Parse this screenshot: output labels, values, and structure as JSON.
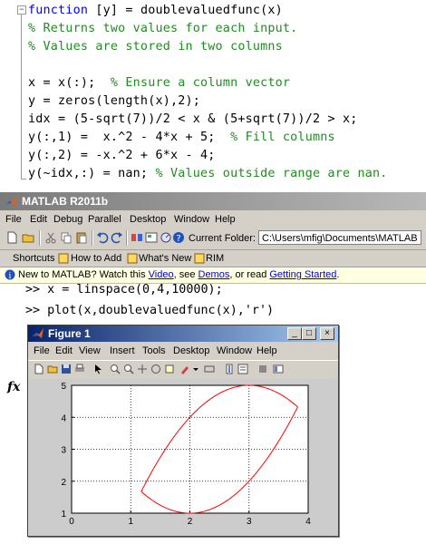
{
  "editor": {
    "fold_glyph": "−",
    "lines": {
      "l1": {
        "kw": "function",
        "rest": " [y] = doublevaluedfunc(x)"
      },
      "l2": "% Returns two values for each input.",
      "l3": "% Values are stored in two columns",
      "l4": {
        "code": "x = x(:);  ",
        "comment": "% Ensure a column vector"
      },
      "l5": "y = zeros(length(x),2);",
      "l6": "idx = (5-sqrt(7))/2 < x & (5+sqrt(7))/2 > x;",
      "l7": {
        "code": "y(:,1) =  x.^2 - 4*x + 5;  ",
        "comment": "% Fill columns"
      },
      "l8": "y(:,2) = -x.^2 + 6*x - 4;",
      "l9": {
        "code": "y(~idx,:) = nan; ",
        "comment": "% Values outside range are nan."
      }
    }
  },
  "matlab": {
    "title": "MATLAB  R2011b",
    "menu": [
      "File",
      "Edit",
      "Debug",
      "Parallel",
      "Desktop",
      "Window",
      "Help"
    ],
    "current_folder_label": "Current Folder:",
    "current_folder_value": "C:\\Users\\mfig\\Documents\\MATLAB",
    "shortcuts": [
      "Shortcuts",
      "How to Add",
      "What's New",
      "RIM"
    ],
    "newbar": {
      "prefix": "New to MATLAB? Watch this ",
      "video": "Video",
      "sep1": ", see ",
      "demos": "Demos",
      "sep2": ", or read ",
      "getting_started": "Getting Started",
      "suffix": "."
    },
    "fx_label": "fx",
    "command_lines": [
      ">> x = linspace(0,4,10000);",
      ">> plot(x,doublevaluedfunc(x),'r')"
    ]
  },
  "figure": {
    "title": "Figure 1",
    "menu": [
      "File",
      "Edit",
      "View",
      "Insert",
      "Tools",
      "Desktop",
      "Window",
      "Help"
    ],
    "win_buttons": {
      "minimize": "_",
      "maximize": "□",
      "close": "×"
    }
  },
  "colors": {
    "keyword": "#0000ff",
    "comment": "#228b22",
    "plot_line": "#ff0000",
    "figure_title": "#0a246a"
  },
  "chart_data": {
    "type": "line",
    "title": "",
    "xlabel": "",
    "ylabel": "",
    "xlim": [
      0,
      4
    ],
    "ylim": [
      1,
      5
    ],
    "xticks": [
      0,
      1,
      2,
      3,
      4
    ],
    "yticks": [
      1,
      2,
      3,
      4,
      5
    ],
    "grid": true,
    "series": [
      {
        "color": "#ff0000",
        "formula": "x^2 - 4x + 5",
        "x": [
          1.177,
          1.5,
          2.0,
          2.5,
          3.0,
          3.5,
          3.823
        ],
        "y": [
          1.677,
          1.25,
          1.0,
          1.25,
          2.0,
          3.25,
          4.323
        ]
      },
      {
        "color": "#ff0000",
        "formula": "-x^2 + 6x - 4",
        "x": [
          1.177,
          1.5,
          2.0,
          2.5,
          3.0,
          3.5,
          3.823
        ],
        "y": [
          1.677,
          2.75,
          4.0,
          4.75,
          5.0,
          4.75,
          4.323
        ]
      }
    ]
  }
}
